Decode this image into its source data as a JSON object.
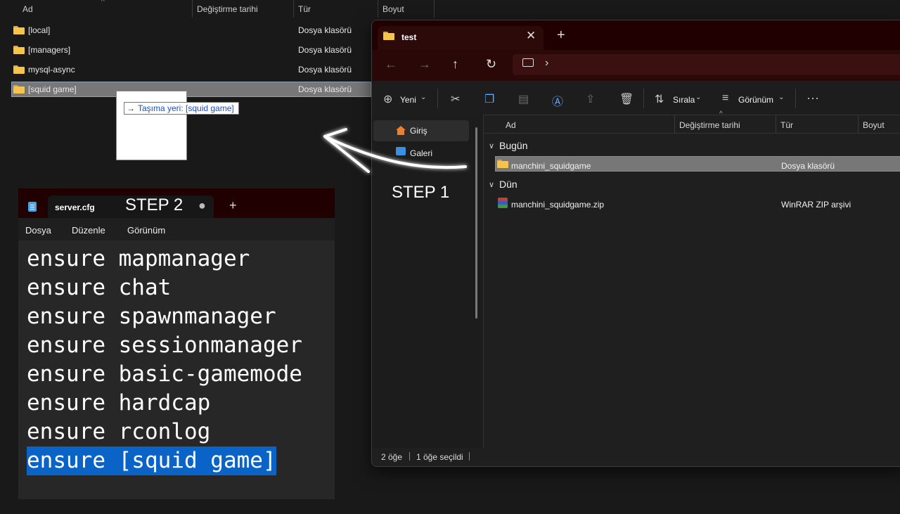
{
  "background_explorer": {
    "columns": [
      "Ad",
      "Değiştirme tarihi",
      "Tür",
      "Boyut"
    ],
    "rows": [
      {
        "name": "[local]",
        "type": "Dosya klasörü"
      },
      {
        "name": "[managers]",
        "type": "Dosya klasörü"
      },
      {
        "name": "mysql-async",
        "type": "Dosya klasörü"
      },
      {
        "name": "[squid game]",
        "type": "Dosya klasörü",
        "selected": true
      }
    ],
    "drag_tooltip": "Taşıma yeri: [squid game]"
  },
  "notepad": {
    "tab_title": "server.cfg",
    "step_label": "STEP 2",
    "new_tab": "+",
    "menu": [
      "Dosya",
      "Düzenle",
      "Görünüm"
    ],
    "lines": [
      "ensure mapmanager",
      "ensure chat",
      "ensure spawnmanager",
      "ensure sessionmanager",
      "ensure basic-gamemode",
      "ensure hardcap",
      "ensure rconlog",
      "ensure [squid game]"
    ],
    "highlighted_line_index": 7
  },
  "explorer": {
    "tab_title": "test",
    "new_tab": "+",
    "commands": {
      "new": "Yeni",
      "sort": "Sırala",
      "view": "Görünüm"
    },
    "nav": [
      "Giriş",
      "Galeri"
    ],
    "columns": [
      "Ad",
      "Değiştirme tarihi",
      "Tür",
      "Boyut"
    ],
    "groups": [
      {
        "label": "Bugün",
        "items": [
          {
            "name": "manchini_squidgame",
            "type": "Dosya klasörü",
            "selected": true
          }
        ]
      },
      {
        "label": "Dün",
        "items": [
          {
            "name": "manchini_squidgame.zip",
            "type": "WinRAR ZIP arşivi"
          }
        ]
      }
    ],
    "status": {
      "count": "2 öğe",
      "selected": "1 öğe seçildi"
    }
  },
  "annotation": {
    "step1": "STEP 1"
  },
  "colors": {
    "selection_blue": "#0a64c8",
    "titlebar_red": "#200000",
    "folder_yellow": "#f5c44a"
  }
}
